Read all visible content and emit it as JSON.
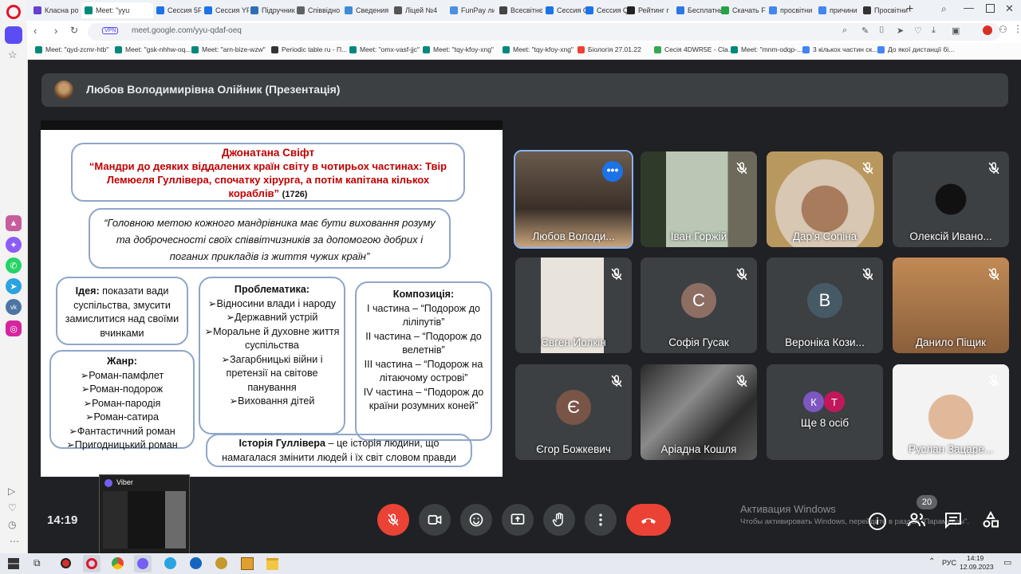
{
  "browser": {
    "tabs": [
      {
        "label": "Класна ро",
        "color": "#6a3fd1"
      },
      {
        "label": "Meet: \"yyu",
        "color": "#00897b",
        "active": true
      },
      {
        "label": "Сессия 5F",
        "color": "#1a73e8"
      },
      {
        "label": "Сессия YF",
        "color": "#1a73e8"
      },
      {
        "label": "Підручник",
        "color": "#2d6fb7"
      },
      {
        "label": "Співвідно",
        "color": "#5f6368"
      },
      {
        "label": "Сведения",
        "color": "#3b8bd5"
      },
      {
        "label": "Ліцей №4",
        "color": "#555555"
      },
      {
        "label": "FunPay ли",
        "color": "#4a90e2"
      },
      {
        "label": "Всесвітнє",
        "color": "#444444"
      },
      {
        "label": "Сессия Q",
        "color": "#1a73e8"
      },
      {
        "label": "Сессия Q",
        "color": "#1a73e8"
      },
      {
        "label": "Рейтинг г",
        "color": "#222222"
      },
      {
        "label": "Бесплатны",
        "color": "#2b78e4"
      },
      {
        "label": "Скачать F",
        "color": "#25a244"
      },
      {
        "label": "просвітни",
        "color": "#4285f4"
      },
      {
        "label": "причини",
        "color": "#4285f4"
      },
      {
        "label": "Просвітни",
        "color": "#333333"
      }
    ],
    "url": "meet.google.com/yyu-qdaf-oeq",
    "vpn_label": "VPN",
    "bookmarks": [
      "Meet: \"qyd-zcmr-htb\"",
      "Meet: \"gsk-nhhw-oq...",
      "Meet: \"arn-bize-wzw\"",
      "Periodic table ru - П...",
      "Meet: \"omx-vasf-jjc\"",
      "Meet: \"tqy-kfoy-xng\"",
      "Meet: \"tqy-kfoy-xng\"",
      "Біологія 27.01.22",
      "Сесія 4DWR5E - Cla...",
      "Meet: \"mnm-odqp-...",
      "3 кількох частин ск...",
      "До якої дистанції бі..."
    ]
  },
  "meet": {
    "presenter_title": "Любов Володимирівна Олійник (Презентація)",
    "slide": {
      "author": "Джонатана Свіфт",
      "title": "“Мандри до деяких віддалених країн світу в чотирьох частинах: Твір Лемюеля Гуллівера, спочатку хірурга, а потім капітана кількох кораблів”",
      "year": "(1726)",
      "quote": "“Головною метою кожного мандрівника має бути виховання розуму та доброчесності своїх співвітчизників за допомогою добрих і поганих прикладів із життя чужих країн”",
      "idea_label": "Ідея:",
      "idea_text": "показати вади суспільства, змусити замислитися над своїми вчинками",
      "genre_title": "Жанр:",
      "genre_items": [
        "➢Роман-памфлет",
        "➢Роман-подорож",
        "➢Роман-пародія",
        "➢Роман-сатира",
        "➢Фантастичний роман",
        "➢Пригодницький роман"
      ],
      "problems_title": "Проблематика:",
      "problems_items": [
        "➢Відносини влади і народу",
        "➢Державний устрій",
        "➢Моральне й духовне життя суспільства",
        "➢Загарбницькі війни і претензії на світове панування",
        "➢Виховання дітей"
      ],
      "composition_title": "Композиція:",
      "composition_items": [
        "І частина – “Подорож до ліліпутів”",
        "ІІ частина – “Подорож до велетнів”",
        "ІІІ частина – “Подорож на літаючому острові”",
        "IV частина – “Подорож до країни розумних коней”"
      ],
      "history_label": "Історія Гуллівера",
      "history_text": " – це історія людини, що намагалася змінити людей і їх світ словом правди"
    },
    "participants": [
      {
        "name": "Любов Володи...",
        "type": "video"
      },
      {
        "name": "Іван Горжій",
        "type": "video"
      },
      {
        "name": "Дар'я Сопіна",
        "type": "video"
      },
      {
        "name": "Олексій Ивано...",
        "type": "video"
      },
      {
        "name": "Євген Йолкін",
        "type": "video"
      },
      {
        "name": "Софія Гусак",
        "type": "avatar",
        "initial": "С",
        "color": "#8d6e63"
      },
      {
        "name": "Вероніка Кози...",
        "type": "avatar",
        "initial": "В",
        "color": "#455a64"
      },
      {
        "name": "Данило Піщик",
        "type": "video"
      },
      {
        "name": "Єгор Божкевич",
        "type": "avatar",
        "initial": "Є",
        "color": "#795548"
      },
      {
        "name": "Аріадна Кошля",
        "type": "video"
      },
      {
        "name": "Ще 8 осіб",
        "type": "more",
        "initials": [
          "К",
          "Т"
        ],
        "colors": [
          "#7e57c2",
          "#c2185b"
        ]
      },
      {
        "name": "Руслан Зацаре...",
        "type": "video"
      }
    ],
    "time": "14:19",
    "participant_count": "20",
    "windows_activation_title": "Активация Windows",
    "windows_activation_text": "Чтобы активировать Windows, перейдите в раздел \"Параметры\".",
    "viber_title": "Viber"
  },
  "taskbar": {
    "lang": "РУС",
    "clock_time": "14:19",
    "clock_date": "12.09.2023"
  }
}
